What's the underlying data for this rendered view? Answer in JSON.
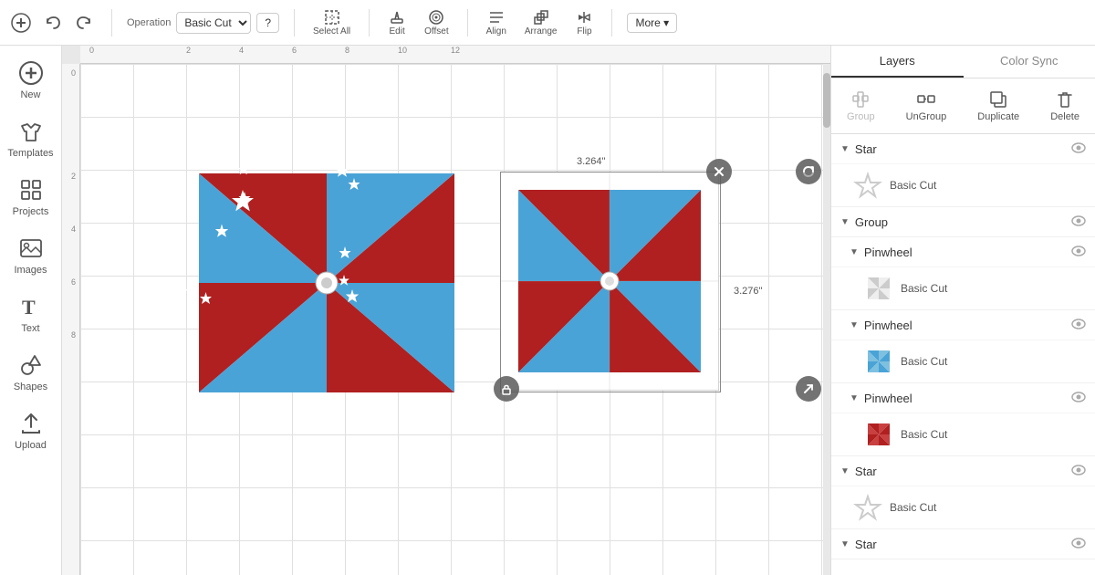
{
  "toolbar": {
    "operation_label": "Operation",
    "operation_value": "Basic Cut",
    "select_all_label": "Select All",
    "edit_label": "Edit",
    "offset_label": "Offset",
    "align_label": "Align",
    "arrange_label": "Arrange",
    "flip_label": "Flip",
    "more_label": "More ▾",
    "help_label": "?"
  },
  "sidebar": {
    "items": [
      {
        "id": "new",
        "label": "New",
        "icon": "plus-icon"
      },
      {
        "id": "templates",
        "label": "Templates",
        "icon": "tshirt-icon"
      },
      {
        "id": "projects",
        "label": "Projects",
        "icon": "grid-icon"
      },
      {
        "id": "images",
        "label": "Images",
        "icon": "image-icon"
      },
      {
        "id": "text",
        "label": "Text",
        "icon": "text-icon"
      },
      {
        "id": "shapes",
        "label": "Shapes",
        "icon": "shapes-icon"
      },
      {
        "id": "upload",
        "label": "Upload",
        "icon": "upload-icon"
      }
    ]
  },
  "right_panel": {
    "tabs": [
      "Layers",
      "Color Sync"
    ],
    "tools": [
      {
        "id": "group",
        "label": "Group",
        "disabled": false
      },
      {
        "id": "ungroup",
        "label": "UnGroup",
        "disabled": false
      },
      {
        "id": "duplicate",
        "label": "Duplicate",
        "disabled": false
      },
      {
        "id": "delete",
        "label": "Delete",
        "disabled": false
      }
    ],
    "layers": [
      {
        "type": "single",
        "name": "Star",
        "visible": true,
        "children": [
          {
            "label": "Basic Cut",
            "color": "#ccc",
            "shape": "star-outline"
          }
        ]
      },
      {
        "type": "group",
        "name": "Group",
        "visible": true,
        "children": [
          {
            "type": "subgroup",
            "name": "Pinwheel",
            "visible": true,
            "children": [
              {
                "label": "Basic Cut",
                "color": "#ccc",
                "shape": "pinwheel-gray"
              }
            ]
          },
          {
            "type": "subgroup",
            "name": "Pinwheel",
            "visible": true,
            "children": [
              {
                "label": "Basic Cut",
                "color": "#4aa3d6",
                "shape": "pinwheel-blue"
              }
            ]
          },
          {
            "type": "subgroup",
            "name": "Pinwheel",
            "visible": true,
            "children": [
              {
                "label": "Basic Cut",
                "color": "#b02020",
                "shape": "pinwheel-red"
              }
            ]
          }
        ]
      },
      {
        "type": "single",
        "name": "Star",
        "visible": true,
        "children": [
          {
            "label": "Basic Cut",
            "color": "#ccc",
            "shape": "star-outline"
          }
        ]
      },
      {
        "type": "single",
        "name": "Star",
        "visible": true,
        "children": []
      }
    ]
  },
  "canvas": {
    "ruler_h": [
      "0",
      "2",
      "4",
      "6",
      "8",
      "10",
      "12"
    ],
    "ruler_v": [
      "0",
      "2",
      "4",
      "6",
      "8"
    ],
    "dimension1": "3.264\"",
    "dimension2": "3.276\""
  },
  "colors": {
    "red": "#b02020",
    "blue": "#4aa3d6",
    "white": "#ffffff",
    "accent": "#666"
  }
}
